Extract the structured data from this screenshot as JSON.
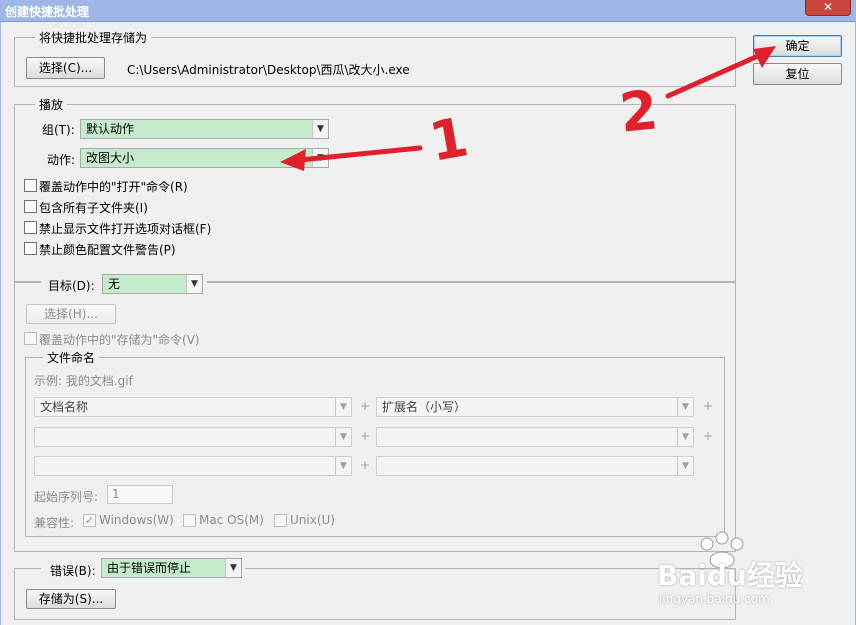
{
  "window": {
    "title": "创建快捷批处理",
    "close": "✕"
  },
  "save_group": {
    "legend": "将快捷批处理存储为",
    "choose_button": "选择(C)...",
    "path": "C:\\Users\\Administrator\\Desktop\\西瓜\\改大小.exe"
  },
  "side_buttons": {
    "ok": "确定",
    "reset": "复位"
  },
  "play_group": {
    "legend": "播放",
    "set_label": "组(T):",
    "set_value": "默认动作",
    "action_label": "动作:",
    "action_value": "改图大小",
    "checkboxes": [
      "覆盖动作中的\"打开\"命令(R)",
      "包含所有子文件夹(I)",
      "禁止显示文件打开选项对话框(F)",
      "禁止颜色配置文件警告(P)"
    ]
  },
  "dest_group": {
    "label": "目标(D):",
    "value": "无",
    "choose_button": "选择(H)...",
    "override_checkbox": "覆盖动作中的\"存储为\"命令(V)"
  },
  "naming_group": {
    "legend": "文件命名",
    "example": "示例: 我的文档.gif",
    "fields": [
      "文档名称",
      "扩展名（小写）",
      "",
      "",
      "",
      ""
    ],
    "plus": "+",
    "start_serial_label": "起始序列号:",
    "start_serial_value": "1",
    "compat_label": "兼容性:",
    "compat_options": [
      {
        "label": "Windows(W)",
        "checked": true
      },
      {
        "label": "Mac OS(M)",
        "checked": false
      },
      {
        "label": "Unix(U)",
        "checked": false
      }
    ]
  },
  "error_group": {
    "label": "错误(B):",
    "value": "由于错误而停止",
    "save_as_button": "存储为(S)..."
  },
  "annotations": {
    "mark1": "1",
    "mark2": "2",
    "arrow_color": "#e0202a"
  },
  "watermark": {
    "brand": "Baidu经验",
    "url": "jingyan.baidu.com"
  },
  "colors": {
    "select_green": "#c6ebcc",
    "titlebar": "#9fb7e6"
  }
}
